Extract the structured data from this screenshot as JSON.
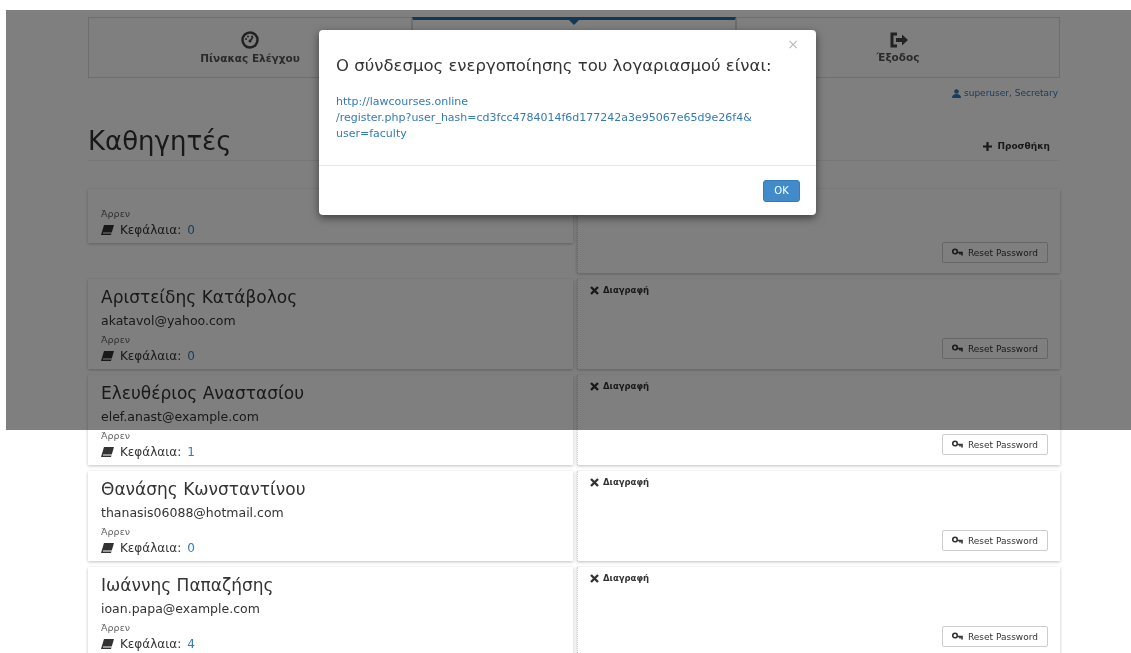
{
  "nav": {
    "tabs": [
      {
        "kind": "gauge",
        "label": "Πίνακας Ελέγχου",
        "selected": false
      },
      {
        "kind": "covered",
        "selected": true
      },
      {
        "kind": "exit",
        "label": "Έξοδος",
        "selected": false
      }
    ]
  },
  "user": "superuser, Secretary",
  "heading": "Καθηγητές",
  "add_button": "Προσθήκη",
  "professors": [
    {
      "gender": "Άρρεν",
      "chapters_label": "Κεφάλαια:",
      "chapters": "0",
      "reset": "Reset Password"
    },
    {
      "name": "Αριστείδης Κατάβολος",
      "email": "akatavol@yahoo.com",
      "gender": "Άρρεν",
      "chapters_label": "Κεφάλαια:",
      "chapters": "0",
      "delete": "Διαγραφή",
      "reset": "Reset Password"
    },
    {
      "name": "Ελευθέριος Αναστασίου",
      "email": "elef.anast@example.com",
      "gender": "Άρρεν",
      "chapters_label": "Κεφάλαια:",
      "chapters": "1",
      "delete": "Διαγραφή",
      "reset": "Reset Password"
    },
    {
      "name": "Θανάσης Κωνσταντίνου",
      "email": "thanasis06088@hotmail.com",
      "gender": "Άρρεν",
      "chapters_label": "Κεφάλαια:",
      "chapters": "0",
      "delete": "Διαγραφή",
      "reset": "Reset Password"
    },
    {
      "name": "Ιωάννης Παπαζήσης",
      "email": "ioan.papa@example.com",
      "gender": "Άρρεν",
      "chapters_label": "Κεφάλαια:",
      "chapters": "4",
      "delete": "Διαγραφή",
      "reset": "Reset Password"
    }
  ],
  "modal": {
    "close": "×",
    "title": "Ο σύνδεσμος ενεργοποίησης του λογαριασμού είναι:",
    "link_lines": [
      "http://lawcourses.online",
      "/register.php?user_hash=cd3fcc4784014f6d177242a3e95067e65d9e26f4&",
      "user=faculty"
    ],
    "ok": "OK"
  }
}
